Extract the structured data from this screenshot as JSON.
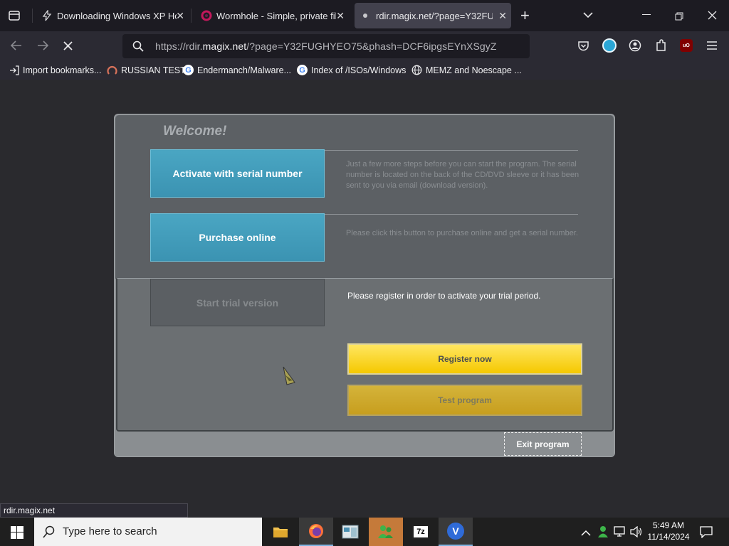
{
  "tabs": [
    {
      "label": "Downloading Windows XP Hor",
      "close": "✕"
    },
    {
      "label": "Wormhole - Simple, private file",
      "close": "✕"
    },
    {
      "label": "rdir.magix.net/?page=Y32FUGH",
      "close": "✕"
    }
  ],
  "new_tab": "+",
  "url": {
    "prefix": "https://rdir.",
    "domain": "magix.net",
    "suffix": "/?page=Y32FUGHYEO75&phash=DCF6ipgsEYnXSgyZ"
  },
  "bookmarks": [
    {
      "label": "Import bookmarks...",
      "icon": "import-icon"
    },
    {
      "label": "RUSSIAN TEST",
      "icon": "site-icon"
    },
    {
      "label": "Endermanch/Malware...",
      "icon": "google-icon"
    },
    {
      "label": "Index of /ISOs/Windows",
      "icon": "google-icon"
    },
    {
      "label": "MEMZ and Noescape ...",
      "icon": "globe-icon"
    }
  ],
  "dialog": {
    "welcome": "Welcome!",
    "activate_label": "Activate with serial number",
    "activate_desc": "Just a few more steps before you can start the program. The serial number is located on the back of the CD/DVD sleeve or it has been sent to you via email (download version).",
    "purchase_label": "Purchase online",
    "purchase_desc": "Please click this button to purchase online and get a serial number.",
    "trial_label": "Start trial version",
    "trial_msg": "Please register in order to activate your trial period.",
    "register_label": "Register now",
    "test_label": "Test program",
    "exit_label": "Exit program"
  },
  "status_link": "rdir.magix.net",
  "taskbar": {
    "search_placeholder": "Type here to search",
    "time": "5:49 AM",
    "date": "11/14/2024"
  },
  "colors": {
    "accent_blue": "#4aa6c3",
    "register_yellow": "#ffe660",
    "test_gold": "#c79e1e"
  }
}
